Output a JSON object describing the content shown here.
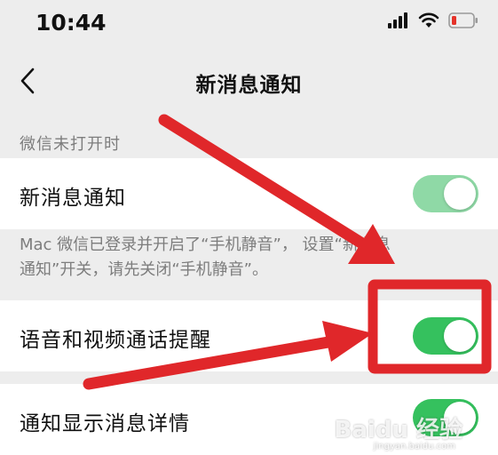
{
  "status_bar": {
    "time": "10:44",
    "icons": [
      "signal-icon",
      "wifi-icon",
      "battery-low-icon"
    ]
  },
  "nav": {
    "back_icon": "chevron-left-icon",
    "title": "新消息通知"
  },
  "section_label": "微信未打开时",
  "rows": [
    {
      "label": "新消息通知",
      "toggle_on": true,
      "toggle_state": "dimmed"
    },
    {
      "label": "语音和视频通话提醒",
      "toggle_on": true,
      "toggle_state": "active"
    },
    {
      "label": "通知显示消息详情",
      "toggle_on": true,
      "toggle_state": "active"
    }
  ],
  "note": {
    "line1": "Mac 微信已登录并开启了“手机静音”，     设置“新消息",
    "line2": "通知”开关，请先关闭“手机静音”。"
  },
  "colors": {
    "toggle_active": "#35c15e",
    "toggle_dimmed": "#8fd9a6",
    "annotation_red": "#e0272a",
    "battery_red": "#e5332a"
  },
  "watermark": {
    "text": "Baidu 经验",
    "sub": "jingyan.baidu.com"
  }
}
